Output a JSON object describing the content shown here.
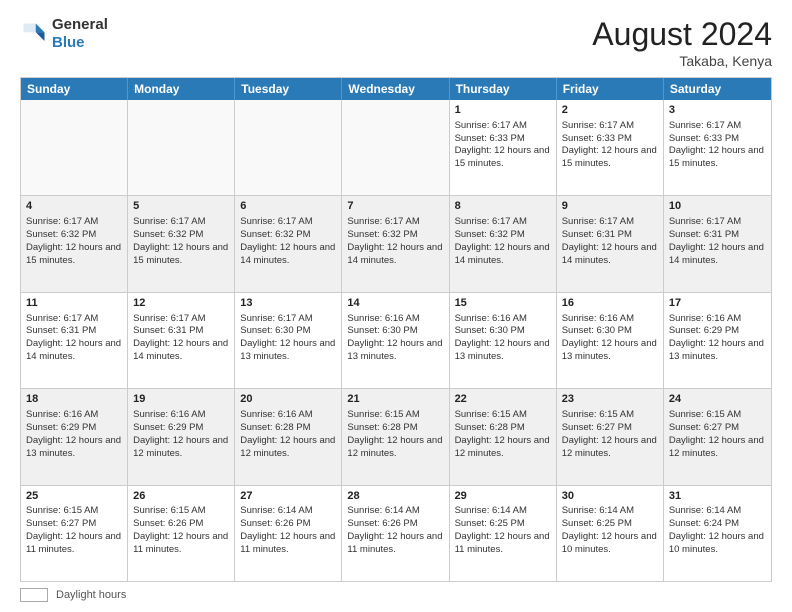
{
  "header": {
    "logo_general": "General",
    "logo_blue": "Blue",
    "month_title": "August 2024",
    "location": "Takaba, Kenya"
  },
  "days_of_week": [
    "Sunday",
    "Monday",
    "Tuesday",
    "Wednesday",
    "Thursday",
    "Friday",
    "Saturday"
  ],
  "footer": {
    "label": "Daylight hours"
  },
  "weeks": [
    {
      "cells": [
        {
          "day": "",
          "empty": true
        },
        {
          "day": "",
          "empty": true
        },
        {
          "day": "",
          "empty": true
        },
        {
          "day": "",
          "empty": true
        },
        {
          "day": "1",
          "sunrise": "Sunrise: 6:17 AM",
          "sunset": "Sunset: 6:33 PM",
          "daylight": "Daylight: 12 hours and 15 minutes."
        },
        {
          "day": "2",
          "sunrise": "Sunrise: 6:17 AM",
          "sunset": "Sunset: 6:33 PM",
          "daylight": "Daylight: 12 hours and 15 minutes."
        },
        {
          "day": "3",
          "sunrise": "Sunrise: 6:17 AM",
          "sunset": "Sunset: 6:33 PM",
          "daylight": "Daylight: 12 hours and 15 minutes."
        }
      ]
    },
    {
      "cells": [
        {
          "day": "4",
          "sunrise": "Sunrise: 6:17 AM",
          "sunset": "Sunset: 6:32 PM",
          "daylight": "Daylight: 12 hours and 15 minutes."
        },
        {
          "day": "5",
          "sunrise": "Sunrise: 6:17 AM",
          "sunset": "Sunset: 6:32 PM",
          "daylight": "Daylight: 12 hours and 15 minutes."
        },
        {
          "day": "6",
          "sunrise": "Sunrise: 6:17 AM",
          "sunset": "Sunset: 6:32 PM",
          "daylight": "Daylight: 12 hours and 14 minutes."
        },
        {
          "day": "7",
          "sunrise": "Sunrise: 6:17 AM",
          "sunset": "Sunset: 6:32 PM",
          "daylight": "Daylight: 12 hours and 14 minutes."
        },
        {
          "day": "8",
          "sunrise": "Sunrise: 6:17 AM",
          "sunset": "Sunset: 6:32 PM",
          "daylight": "Daylight: 12 hours and 14 minutes."
        },
        {
          "day": "9",
          "sunrise": "Sunrise: 6:17 AM",
          "sunset": "Sunset: 6:31 PM",
          "daylight": "Daylight: 12 hours and 14 minutes."
        },
        {
          "day": "10",
          "sunrise": "Sunrise: 6:17 AM",
          "sunset": "Sunset: 6:31 PM",
          "daylight": "Daylight: 12 hours and 14 minutes."
        }
      ]
    },
    {
      "cells": [
        {
          "day": "11",
          "sunrise": "Sunrise: 6:17 AM",
          "sunset": "Sunset: 6:31 PM",
          "daylight": "Daylight: 12 hours and 14 minutes."
        },
        {
          "day": "12",
          "sunrise": "Sunrise: 6:17 AM",
          "sunset": "Sunset: 6:31 PM",
          "daylight": "Daylight: 12 hours and 14 minutes."
        },
        {
          "day": "13",
          "sunrise": "Sunrise: 6:17 AM",
          "sunset": "Sunset: 6:30 PM",
          "daylight": "Daylight: 12 hours and 13 minutes."
        },
        {
          "day": "14",
          "sunrise": "Sunrise: 6:16 AM",
          "sunset": "Sunset: 6:30 PM",
          "daylight": "Daylight: 12 hours and 13 minutes."
        },
        {
          "day": "15",
          "sunrise": "Sunrise: 6:16 AM",
          "sunset": "Sunset: 6:30 PM",
          "daylight": "Daylight: 12 hours and 13 minutes."
        },
        {
          "day": "16",
          "sunrise": "Sunrise: 6:16 AM",
          "sunset": "Sunset: 6:30 PM",
          "daylight": "Daylight: 12 hours and 13 minutes."
        },
        {
          "day": "17",
          "sunrise": "Sunrise: 6:16 AM",
          "sunset": "Sunset: 6:29 PM",
          "daylight": "Daylight: 12 hours and 13 minutes."
        }
      ]
    },
    {
      "cells": [
        {
          "day": "18",
          "sunrise": "Sunrise: 6:16 AM",
          "sunset": "Sunset: 6:29 PM",
          "daylight": "Daylight: 12 hours and 13 minutes."
        },
        {
          "day": "19",
          "sunrise": "Sunrise: 6:16 AM",
          "sunset": "Sunset: 6:29 PM",
          "daylight": "Daylight: 12 hours and 12 minutes."
        },
        {
          "day": "20",
          "sunrise": "Sunrise: 6:16 AM",
          "sunset": "Sunset: 6:28 PM",
          "daylight": "Daylight: 12 hours and 12 minutes."
        },
        {
          "day": "21",
          "sunrise": "Sunrise: 6:15 AM",
          "sunset": "Sunset: 6:28 PM",
          "daylight": "Daylight: 12 hours and 12 minutes."
        },
        {
          "day": "22",
          "sunrise": "Sunrise: 6:15 AM",
          "sunset": "Sunset: 6:28 PM",
          "daylight": "Daylight: 12 hours and 12 minutes."
        },
        {
          "day": "23",
          "sunrise": "Sunrise: 6:15 AM",
          "sunset": "Sunset: 6:27 PM",
          "daylight": "Daylight: 12 hours and 12 minutes."
        },
        {
          "day": "24",
          "sunrise": "Sunrise: 6:15 AM",
          "sunset": "Sunset: 6:27 PM",
          "daylight": "Daylight: 12 hours and 12 minutes."
        }
      ]
    },
    {
      "cells": [
        {
          "day": "25",
          "sunrise": "Sunrise: 6:15 AM",
          "sunset": "Sunset: 6:27 PM",
          "daylight": "Daylight: 12 hours and 11 minutes."
        },
        {
          "day": "26",
          "sunrise": "Sunrise: 6:15 AM",
          "sunset": "Sunset: 6:26 PM",
          "daylight": "Daylight: 12 hours and 11 minutes."
        },
        {
          "day": "27",
          "sunrise": "Sunrise: 6:14 AM",
          "sunset": "Sunset: 6:26 PM",
          "daylight": "Daylight: 12 hours and 11 minutes."
        },
        {
          "day": "28",
          "sunrise": "Sunrise: 6:14 AM",
          "sunset": "Sunset: 6:26 PM",
          "daylight": "Daylight: 12 hours and 11 minutes."
        },
        {
          "day": "29",
          "sunrise": "Sunrise: 6:14 AM",
          "sunset": "Sunset: 6:25 PM",
          "daylight": "Daylight: 12 hours and 11 minutes."
        },
        {
          "day": "30",
          "sunrise": "Sunrise: 6:14 AM",
          "sunset": "Sunset: 6:25 PM",
          "daylight": "Daylight: 12 hours and 10 minutes."
        },
        {
          "day": "31",
          "sunrise": "Sunrise: 6:14 AM",
          "sunset": "Sunset: 6:24 PM",
          "daylight": "Daylight: 12 hours and 10 minutes."
        }
      ]
    }
  ]
}
